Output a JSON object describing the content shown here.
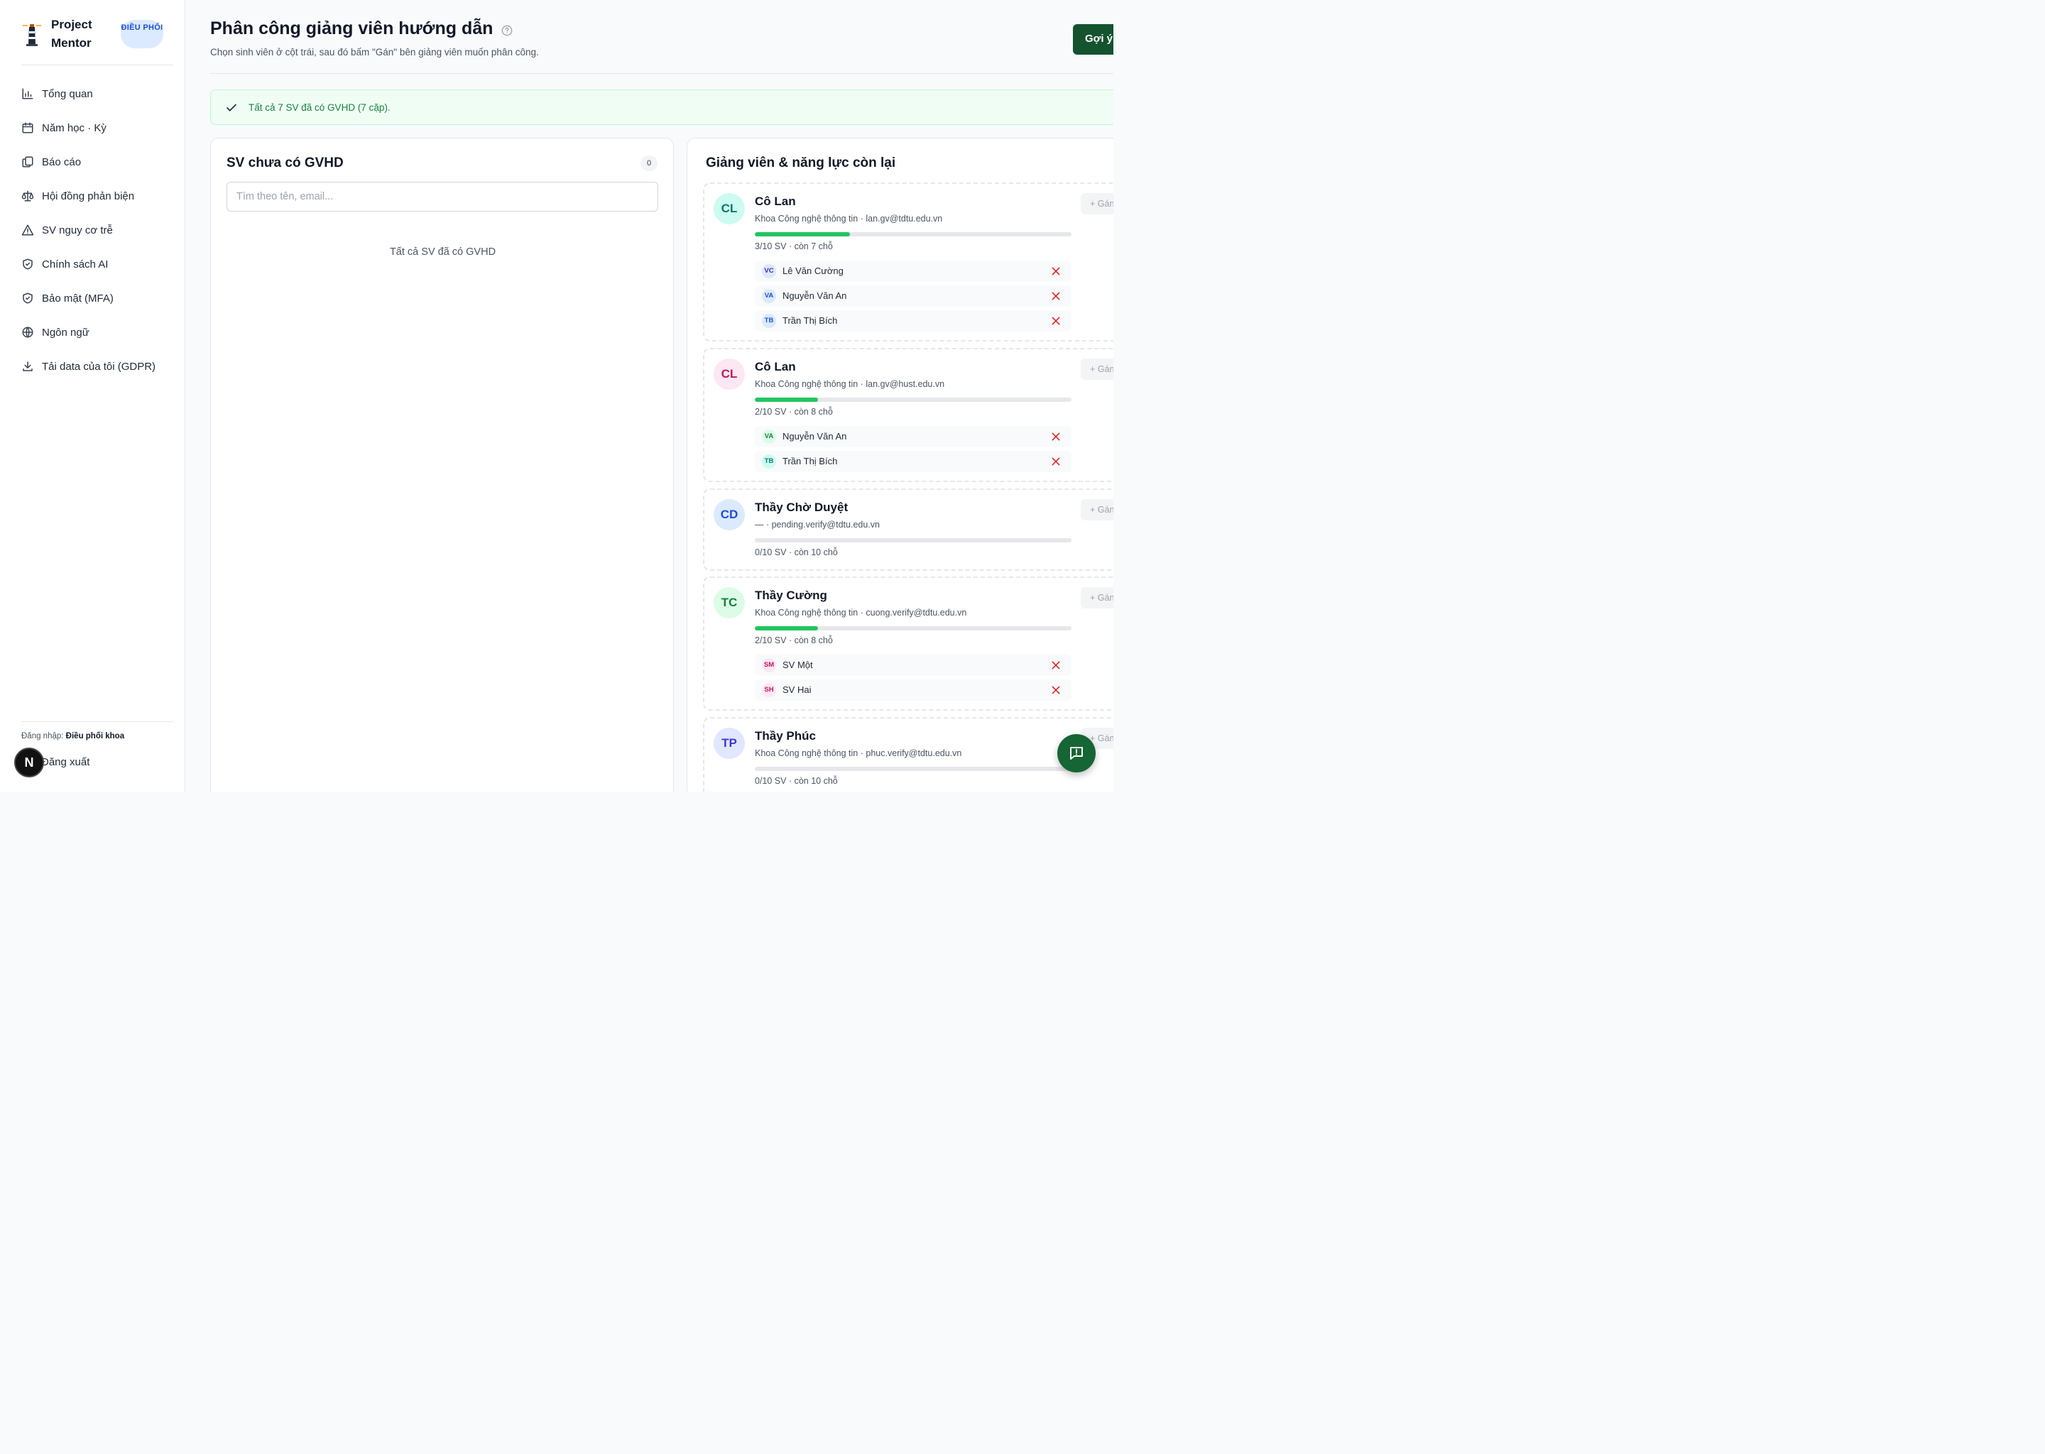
{
  "app": {
    "name": "Project Mentor",
    "role_badge": "ĐIỀU PHỐI"
  },
  "sidebar": {
    "items": [
      {
        "label": "Tổng quan",
        "icon": "bar-chart-icon"
      },
      {
        "label": "Năm học · Kỳ",
        "icon": "calendar-icon"
      },
      {
        "label": "Báo cáo",
        "icon": "copy-docs-icon"
      },
      {
        "label": "Hội đồng phản biện",
        "icon": "scale-icon"
      },
      {
        "label": "SV nguy cơ trễ",
        "icon": "warning-icon"
      },
      {
        "label": "Chính sách AI",
        "icon": "shield-check-icon"
      },
      {
        "label": "Bảo mật (MFA)",
        "icon": "shield-check-icon"
      },
      {
        "label": "Ngôn ngữ",
        "icon": "globe-icon"
      },
      {
        "label": "Tải data của tôi (GDPR)",
        "icon": "download-icon"
      }
    ],
    "login_label": "Đăng nhập:",
    "login_user": "Điều phối khoa",
    "logout_label": "Đăng xuất",
    "n_badge": "N"
  },
  "header": {
    "title": "Phân công giảng viên hướng dẫn",
    "subtitle": "Chọn sinh viên ở cột trái, sau đó bấm \"Gán\" bên giảng viên muốn phân công.",
    "suggest_label": "Gợi ý"
  },
  "alert": {
    "text": "Tất cả 7 SV đã có GVHD (7 cặp)."
  },
  "left_panel": {
    "title": "SV chưa có GVHD",
    "count": "0",
    "search_placeholder": "Tìm theo tên, email...",
    "empty_text": "Tất cả SV đã có GVHD"
  },
  "right_panel": {
    "title": "Giảng viên & năng lực còn lại",
    "assign_label": "+ Gán",
    "teachers": [
      {
        "initials": "CL",
        "name": "Cô Lan",
        "dept": "Khoa Công nghệ thông tin · lan.gv@tdtu.edu.vn",
        "capacity": "3/10 SV · còn 7 chỗ",
        "load": 0.3,
        "avatar_bg": "#ccfbf1",
        "avatar_fg": "#0f766e",
        "students": [
          {
            "initials": "VC",
            "name": "Lê Văn Cường",
            "bg": "#e0e7ff",
            "fg": "#3730a3"
          },
          {
            "initials": "VA",
            "name": "Nguyễn Văn An",
            "bg": "#dbeafe",
            "fg": "#1d4ed8"
          },
          {
            "initials": "TB",
            "name": "Trần Thị Bích",
            "bg": "#dbeafe",
            "fg": "#1d4ed8"
          }
        ]
      },
      {
        "initials": "CL",
        "name": "Cô Lan",
        "dept": "Khoa Công nghệ thông tin · lan.gv@hust.edu.vn",
        "capacity": "2/10 SV · còn 8 chỗ",
        "load": 0.2,
        "avatar_bg": "#fce7f3",
        "avatar_fg": "#be185d",
        "students": [
          {
            "initials": "VA",
            "name": "Nguyễn Văn An",
            "bg": "#dcfce7",
            "fg": "#15803d"
          },
          {
            "initials": "TB",
            "name": "Trần Thị Bích",
            "bg": "#ccfbf1",
            "fg": "#0f766e"
          }
        ]
      },
      {
        "initials": "CD",
        "name": "Thầy Chờ Duyệt",
        "dept": "— · pending.verify@tdtu.edu.vn",
        "capacity": "0/10 SV · còn 10 chỗ",
        "load": 0,
        "avatar_bg": "#dbeafe",
        "avatar_fg": "#1d4ed8",
        "students": []
      },
      {
        "initials": "TC",
        "name": "Thầy Cường",
        "dept": "Khoa Công nghệ thông tin · cuong.verify@tdtu.edu.vn",
        "capacity": "2/10 SV · còn 8 chỗ",
        "load": 0.2,
        "avatar_bg": "#dcfce7",
        "avatar_fg": "#15803d",
        "students": [
          {
            "initials": "SM",
            "name": "SV Một",
            "bg": "#fce7f3",
            "fg": "#be185d"
          },
          {
            "initials": "SH",
            "name": "SV Hai",
            "bg": "#fce7f3",
            "fg": "#be185d"
          }
        ]
      },
      {
        "initials": "TP",
        "name": "Thầy Phúc",
        "dept": "Khoa Công nghệ thông tin · phuc.verify@tdtu.edu.vn",
        "capacity": "0/10 SV · còn 10 chỗ",
        "load": 0,
        "avatar_bg": "#e0e7ff",
        "avatar_fg": "#4338ca",
        "students": []
      }
    ]
  },
  "colors": {
    "primary": "#14532d",
    "progress": "#22c55e",
    "remove": "#dc2626",
    "alert_bg": "#f0fdf4"
  }
}
